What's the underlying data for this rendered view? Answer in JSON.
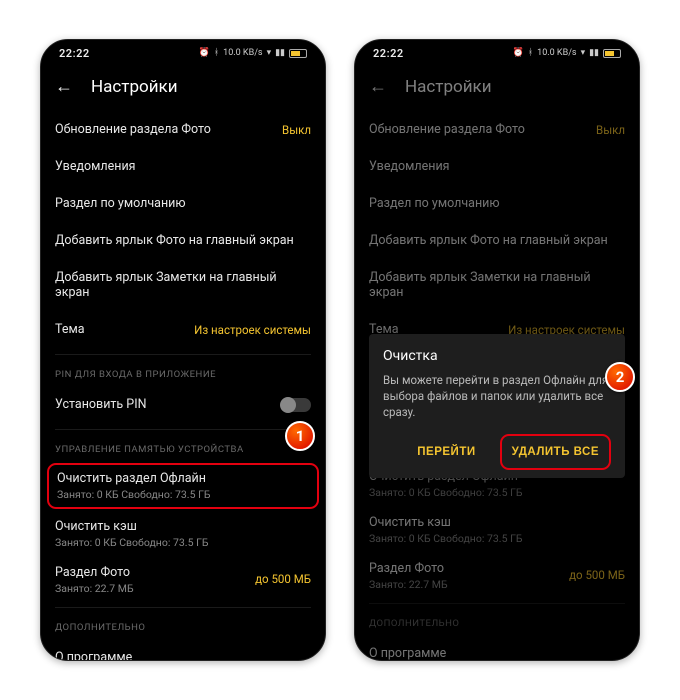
{
  "status": {
    "time": "22:22",
    "net": "10.0 KB/s"
  },
  "header": {
    "title": "Настройки"
  },
  "settings": {
    "photo_update": {
      "label": "Обновление раздела Фото",
      "value": "Выкл"
    },
    "notifications": {
      "label": "Уведомления"
    },
    "default_section": {
      "label": "Раздел по умолчанию"
    },
    "photo_shortcut": {
      "label": "Добавить ярлык Фото на главный экран"
    },
    "notes_shortcut": {
      "label": "Добавить ярлык Заметки на главный экран"
    },
    "theme": {
      "label": "Тема",
      "value": "Из настроек системы"
    }
  },
  "pin_section": {
    "heading": "PIN ДЛЯ ВХОДА В ПРИЛОЖЕНИЕ",
    "set_pin": "Установить PIN"
  },
  "storage_section": {
    "heading": "УПРАВЛЕНИЕ ПАМЯТЬЮ УСТРОЙСТВА",
    "offline": {
      "title": "Очистить раздел Офлайн",
      "sub": "Занято: 0 КБ Свободно: 73.5 ГБ"
    },
    "cache": {
      "title": "Очистить кэш",
      "sub": "Занято: 0 КБ Свободно: 73.5 ГБ"
    },
    "photo": {
      "title": "Раздел Фото",
      "sub": "Занято: 22.7 МБ",
      "value": "до 500 МБ"
    }
  },
  "extra_section": {
    "heading": "ДОПОЛНИТЕЛЬНО",
    "about": "О программе"
  },
  "dialog": {
    "title": "Очистка",
    "text": "Вы можете перейти в раздел Офлайн для выбора файлов и папок или удалить все сразу.",
    "go": "ПЕРЕЙТИ",
    "delete_all": "УДАЛИТЬ ВСЕ"
  },
  "callouts": {
    "one": "1",
    "two": "2"
  }
}
